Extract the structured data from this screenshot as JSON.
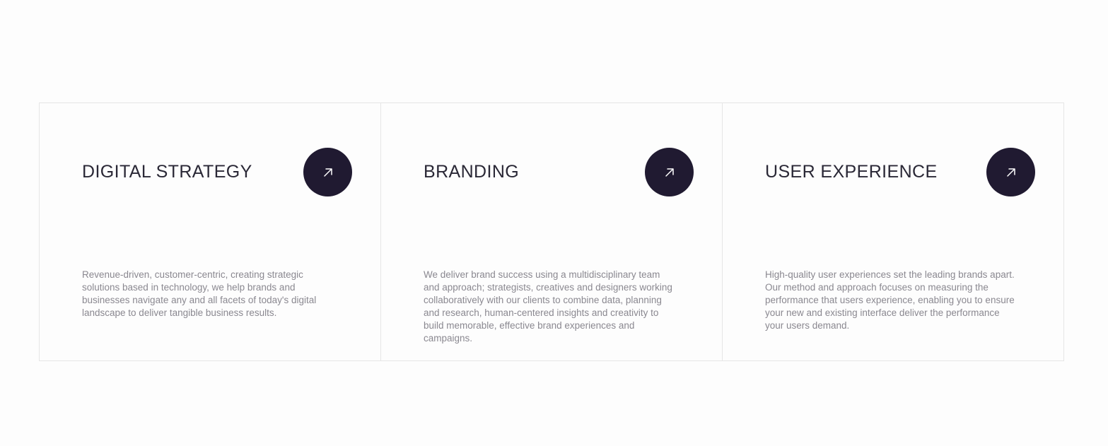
{
  "services": [
    {
      "title": "DIGITAL STRATEGY",
      "icon": "arrow-up-right-icon",
      "description": "Revenue-driven, customer-centric, creating strategic solutions based in technology, we help brands and businesses navigate any and all facets of today's digital landscape to deliver tangible business results."
    },
    {
      "title": "BRANDING",
      "icon": "arrow-up-right-icon",
      "description": "We deliver brand success using a multidisciplinary team and approach; strategists, creatives and designers working collaboratively with our clients to combine data, planning and research, human-centered insights and creativity to build memorable, effective brand experiences and campaigns."
    },
    {
      "title": "USER EXPERIENCE",
      "icon": "arrow-up-right-icon",
      "description": "High-quality user experiences set the leading brands apart. Our method and approach focuses on measuring the performance that users experience, enabling you to ensure your new and existing interface deliver the performance your users demand."
    }
  ],
  "colors": {
    "background": "#fdfdfd",
    "border": "#e6e6e6",
    "title": "#2a2836",
    "button": "#201a31",
    "button_icon": "#ffffff",
    "description": "#8a8890"
  }
}
